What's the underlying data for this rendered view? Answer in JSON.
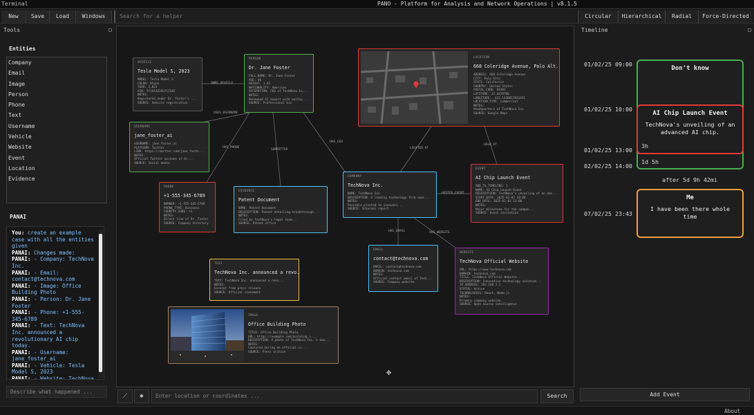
{
  "window": {
    "terminal_label": "Terminal",
    "title": "PANO - Platform for Analysis and Network Operations | v8.1.5"
  },
  "toolbar": {
    "new": "New",
    "save": "Save",
    "load": "Load",
    "windows": "Windows",
    "search_placeholder": "Search for a helper",
    "layouts": [
      "Circular",
      "Hierarchical",
      "Radial",
      "Force-Directed"
    ]
  },
  "tools": {
    "header": "Tools",
    "entities_title": "Entities",
    "entities": [
      "Company",
      "Email",
      "Image",
      "Person",
      "Phone",
      "Text",
      "Username",
      "Vehicle",
      "Website",
      "Event",
      "Location",
      "Evidence"
    ]
  },
  "panai": {
    "title": "PANAI",
    "messages": [
      {
        "who": "You:",
        "text": "create an example case with all the entities given"
      },
      {
        "who": "PANAI:",
        "text": "Changes made:"
      },
      {
        "who": "PANAI:",
        "text": "- Company: TechNova Inc."
      },
      {
        "who": "PANAI:",
        "text": "- Email: contact@technova.com"
      },
      {
        "who": "PANAI:",
        "text": "- Image: Office Building Photo"
      },
      {
        "who": "PANAI:",
        "text": "- Person: Dr. Jane Foster"
      },
      {
        "who": "PANAI:",
        "text": "- Phone: +1-555-345-6789"
      },
      {
        "who": "PANAI:",
        "text": "- Text: TechNova Inc. announced a revolutionary AI chip today."
      },
      {
        "who": "PANAI:",
        "text": "- Username: jane_foster_ai"
      },
      {
        "who": "PANAI:",
        "text": "- Vehicle: Tesla Model S, 2023"
      },
      {
        "who": "PANAI:",
        "text": "- Website: TechNova"
      }
    ],
    "input_placeholder": "Describe what happened ..."
  },
  "graph": {
    "nodes": {
      "vehicle": {
        "type": "VEHICLE",
        "name": "Tesla Model S, 2023",
        "attrs": [
          "MODEL: Tesla Model S",
          "COLOR: Black",
          "YEAR: 2.023",
          "VIN: 5YJSA1E2XLF12345",
          "NOTES:",
          "Registered under Dr. Foster's ...",
          "SOURCE: Vehicle registration"
        ]
      },
      "person": {
        "type": "PERSON",
        "name": "Dr. Jane Foster",
        "attrs": [
          "FULL_NAME: Dr. Jane Foster",
          "AGE: 40",
          "HEIGHT: 1.65",
          "NATIONALITY: American",
          "OCCUPATION: CEO of TechNova In...",
          "NOTES:",
          "Renowned AI expert with multip...",
          "SOURCE: Professional bio"
        ]
      },
      "location": {
        "type": "LOCATION",
        "name": "668 Coleridge Avenue, Palo Alt...",
        "attrs": [
          "ADDRESS: 668 Coleridge Avenue",
          "CITY: Palo Alto",
          "STATE: California",
          "COUNTRY: United States",
          "POSTAL_CODE: 94301",
          "LATITUDE: 37.4419700",
          "LONGITUDE: -122.1430817811451",
          "LOCATION_TYPE: Commercial",
          "NOTES:",
          "Headquarters of TechNova Inc.",
          "SOURCE: Google Maps"
        ]
      },
      "username": {
        "type": "USERNAME",
        "name": "jane_foster_ai",
        "attrs": [
          "USERNAME: jane_foster_ai",
          "PLATFORM: Twitter",
          "LINK: https://twitter.com/jane_foste...",
          "NOTES:",
          "Official Twitter account of Dr...",
          "SOURCE: Social media"
        ]
      },
      "phone": {
        "type": "PHONE",
        "name": "+1-555-345-6789",
        "attrs": [
          "NUMBER: +1-555-345-6789",
          "PHONE_TYPE: Business",
          "COUNTRY_CODE: +1",
          "NOTES:",
          "Direct line of Dr. Foster",
          "SOURCE: Company directory"
        ]
      },
      "evidence": {
        "type": "EVIDENCE",
        "name": "Patent Document",
        "attrs": [
          "NAME: Patent Document",
          "DESCRIPTION: Patent detailing breakthrough...",
          "NOTES:",
          "Filed by TechNova's legal team...",
          "SOURCE: Patent office"
        ]
      },
      "company": {
        "type": "COMPANY",
        "name": "TechNova Inc.",
        "attrs": [
          "NAME: TechNova Inc.",
          "DESCRIPTION: A leading technology firm spec...",
          "NOTES:",
          "Possible pivoted to innovati...",
          "SOURCE: Internal report"
        ]
      },
      "event": {
        "type": "EVENT",
        "name": "AI Chip Launch Event",
        "attrs": [
          "ADD_TO_TIMELINE: 1",
          "NAME: AI Chip Launch Event",
          "DESCRIPTION: TechNova's unveiling of an adv...",
          "START_DATE: 2025-01-02 10:00",
          "END_DATE: 2025-01-02 13:00",
          "NOTES:",
          "Major milestone for the compan...",
          "SOURCE: Event invitation"
        ]
      },
      "text": {
        "type": "TEXT",
        "name": "TechNova Inc. announced a revo...",
        "attrs": [
          "TEXT: TechNova Inc. announced a revo...",
          "NOTES:",
          "Excerpt from press release",
          "SOURCE: Official statement"
        ]
      },
      "email": {
        "type": "EMAIL",
        "name": "contact@technova.com",
        "attrs": [
          "EMAIL: contact@technova.com",
          "DOMAIN: technova.com",
          "NOTES:",
          "Official contact email of Tech...",
          "SOURCE: Company website"
        ]
      },
      "website": {
        "type": "WEBSITE",
        "name": "TechNova Official Website",
        "attrs": [
          "URL: https://www.technova.com",
          "DOMAIN: technova.com",
          "TITLE: TechNova Official Website",
          "DESCRIPTION: Innovative technology solution...",
          "IP_ADDRESS: 192.168.1.1",
          "STATUS: Active",
          "TECHNOLOGIES: React, Node.js",
          "NOTES:",
          "Primary company website.",
          "SOURCE: Open source intelligence"
        ]
      },
      "image": {
        "type": "IMAGE",
        "name": "Office Building Photo",
        "attrs": [
          "TITLE: Office Building Photo",
          "URL: https://example.com/building_i...",
          "DESCRIPTION: A photo of TechNova Inc.'s hea...",
          "NOTES:",
          "Captured during an official vi...",
          "SOURCE: Press archive"
        ]
      }
    },
    "edges": [
      "OWNS_VEHICLE",
      "USES_USERNAME",
      "HAS_PHONE",
      "SUBMITTED",
      "HAS_CEO",
      "LOCATED_AT",
      "HELD_AT",
      "HOSTED_EVENT",
      "HAS_EMAIL",
      "HAS_WEBSITE"
    ]
  },
  "bottom": {
    "location_placeholder": "Enter location or coordinates ...",
    "search": "Search"
  },
  "timeline": {
    "header": "Timeline",
    "times": [
      "01/02/25 09:00",
      "01/02/25 10:00",
      "01/02/25 13:00",
      "02/02/25 14:00",
      "07/02/25 23:43"
    ],
    "events": [
      {
        "title": "Don't know",
        "desc": "",
        "duration": ""
      },
      {
        "title": "AI Chip Launch Event",
        "desc": "TechNova's unveiling of an advanced AI chip.",
        "duration": "3h"
      },
      {
        "title": "",
        "desc": "",
        "duration": "1d 5h"
      },
      {
        "title": "Me",
        "desc": "I have been there whole time",
        "duration": ""
      }
    ],
    "gap": "after 5d 9h 42mi",
    "add_event": "Add Event",
    "colors": {
      "green": "#4caf50",
      "red": "#e53935",
      "orange": "#f0a040"
    }
  },
  "status": {
    "about": "About"
  }
}
